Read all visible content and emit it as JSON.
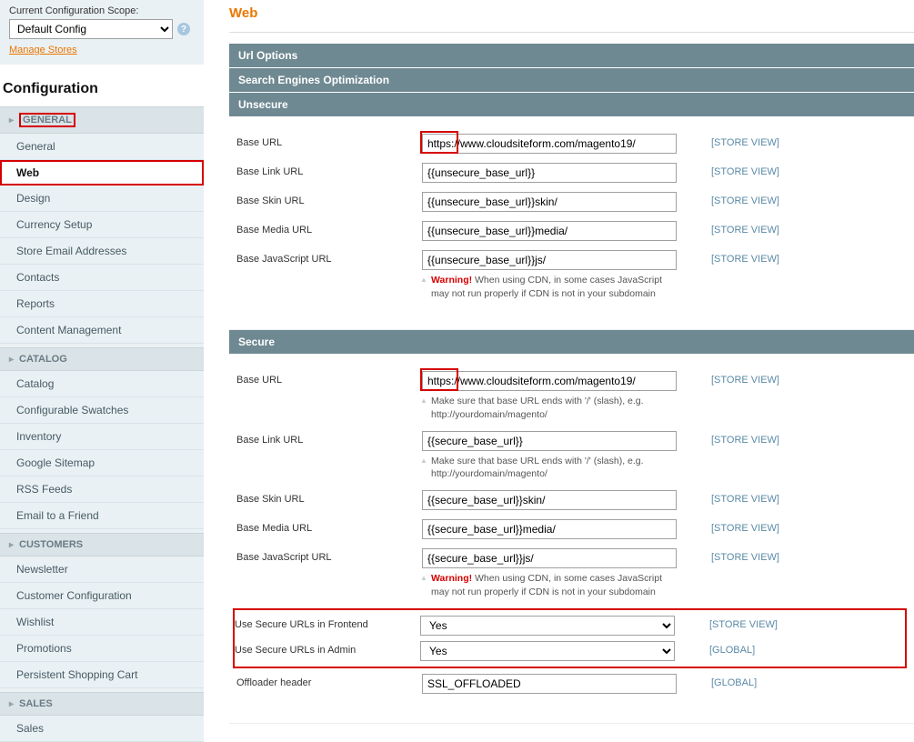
{
  "sidebar": {
    "scope_label": "Current Configuration Scope:",
    "scope_value": "Default Config",
    "manage_stores": "Manage Stores",
    "config_title": "Configuration",
    "sections": [
      {
        "title": "GENERAL",
        "items": [
          "General",
          "Web",
          "Design",
          "Currency Setup",
          "Store Email Addresses",
          "Contacts",
          "Reports",
          "Content Management"
        ]
      },
      {
        "title": "CATALOG",
        "items": [
          "Catalog",
          "Configurable Swatches",
          "Inventory",
          "Google Sitemap",
          "RSS Feeds",
          "Email to a Friend"
        ]
      },
      {
        "title": "CUSTOMERS",
        "items": [
          "Newsletter",
          "Customer Configuration",
          "Wishlist",
          "Promotions",
          "Persistent Shopping Cart"
        ]
      },
      {
        "title": "SALES",
        "items": [
          "Sales"
        ]
      }
    ]
  },
  "page": {
    "title": "Web",
    "headers": {
      "url_options": "Url Options",
      "seo": "Search Engines Optimization",
      "unsecure": "Unsecure",
      "secure": "Secure"
    }
  },
  "unsecure": {
    "base_url_label": "Base URL",
    "base_url_value": "https://www.cloudsiteform.com/magento19/",
    "base_link_label": "Base Link URL",
    "base_link_value": "{{unsecure_base_url}}",
    "base_skin_label": "Base Skin URL",
    "base_skin_value": "{{unsecure_base_url}}skin/",
    "base_media_label": "Base Media URL",
    "base_media_value": "{{unsecure_base_url}}media/",
    "base_js_label": "Base JavaScript URL",
    "base_js_value": "{{unsecure_base_url}}js/",
    "js_note_warn": "Warning!",
    "js_note_rest": " When using CDN, in some cases JavaScript may not run properly if CDN is not in your subdomain"
  },
  "secure": {
    "base_url_label": "Base URL",
    "base_url_value": "https://www.cloudsiteform.com/magento19/",
    "base_url_note": "Make sure that base URL ends with '/' (slash), e.g. http://yourdomain/magento/",
    "base_link_label": "Base Link URL",
    "base_link_value": "{{secure_base_url}}",
    "base_link_note": "Make sure that base URL ends with '/' (slash), e.g. http://yourdomain/magento/",
    "base_skin_label": "Base Skin URL",
    "base_skin_value": "{{secure_base_url}}skin/",
    "base_media_label": "Base Media URL",
    "base_media_value": "{{secure_base_url}}media/",
    "base_js_label": "Base JavaScript URL",
    "base_js_value": "{{secure_base_url}}js/",
    "js_note_warn": "Warning!",
    "js_note_rest": " When using CDN, in some cases JavaScript may not run properly if CDN is not in your subdomain",
    "use_fe_label": "Use Secure URLs in Frontend",
    "use_fe_value": "Yes",
    "use_admin_label": "Use Secure URLs in Admin",
    "use_admin_value": "Yes",
    "offload_label": "Offloader header",
    "offload_value": "SSL_OFFLOADED"
  },
  "scopes": {
    "store_view": "[STORE VIEW]",
    "global": "[GLOBAL]"
  }
}
